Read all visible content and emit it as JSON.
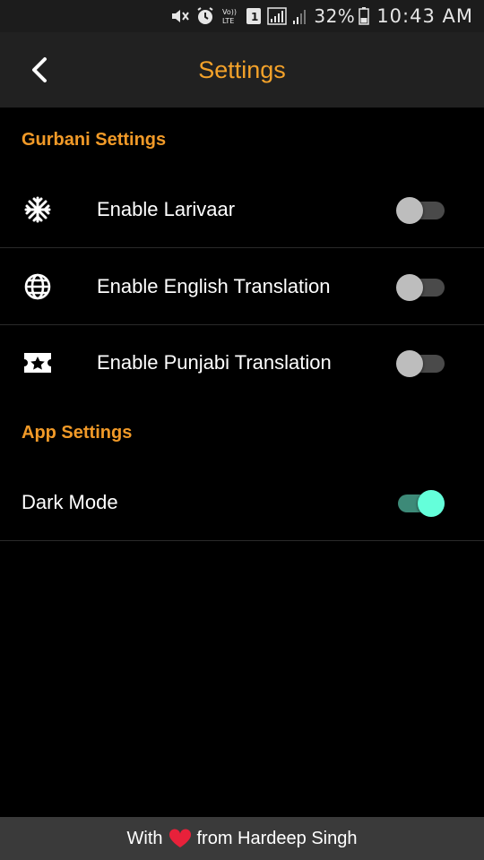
{
  "status_bar": {
    "battery_percent": "32%",
    "time": "10:43 AM",
    "volte_label": "Vo))\nLTE",
    "sim_label": "1",
    "icons": [
      "mute-icon",
      "alarm-icon",
      "volte-icon",
      "sim-1-icon",
      "signal-icon",
      "signal-weak-icon",
      "battery-icon"
    ]
  },
  "app_bar": {
    "title": "Settings",
    "back_icon": "chevron-left-icon"
  },
  "sections": [
    {
      "header": "Gurbani Settings",
      "items": [
        {
          "label": "Enable Larivaar",
          "icon": "snowflake-icon",
          "enabled": false
        },
        {
          "label": "Enable English Translation",
          "icon": "globe-icon",
          "enabled": false
        },
        {
          "label": "Enable Punjabi Translation",
          "icon": "ticket-star-icon",
          "enabled": false
        }
      ]
    },
    {
      "header": "App Settings",
      "items": [
        {
          "label": "Dark Mode",
          "enabled": true
        }
      ]
    }
  ],
  "footer": {
    "prefix": "With",
    "heart_icon": "heart-icon",
    "suffix": "from Hardeep Singh"
  },
  "colors": {
    "accent": "#f4a22a",
    "switch_on": "#64ffda",
    "background": "#000000",
    "app_bar": "#212121",
    "footer": "#3a3a3a"
  }
}
